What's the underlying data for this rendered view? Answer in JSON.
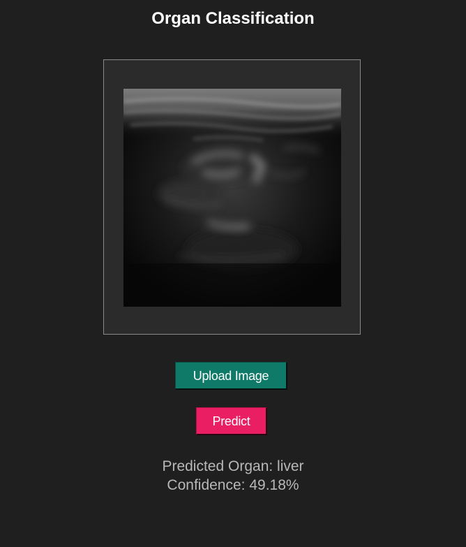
{
  "app": {
    "title": "Organ Classification"
  },
  "image_panel": {
    "image_description": "ultrasound-scan"
  },
  "buttons": {
    "upload_label": "Upload Image",
    "predict_label": "Predict"
  },
  "result": {
    "predicted_organ_line": "Predicted Organ: liver",
    "confidence_line": "Confidence: 49.18%"
  },
  "colors": {
    "background": "#1f1f1f",
    "panel": "#2b2b2b",
    "upload_button": "#0f7a68",
    "predict_button": "#e91e63",
    "result_text": "#b8b8b8"
  }
}
